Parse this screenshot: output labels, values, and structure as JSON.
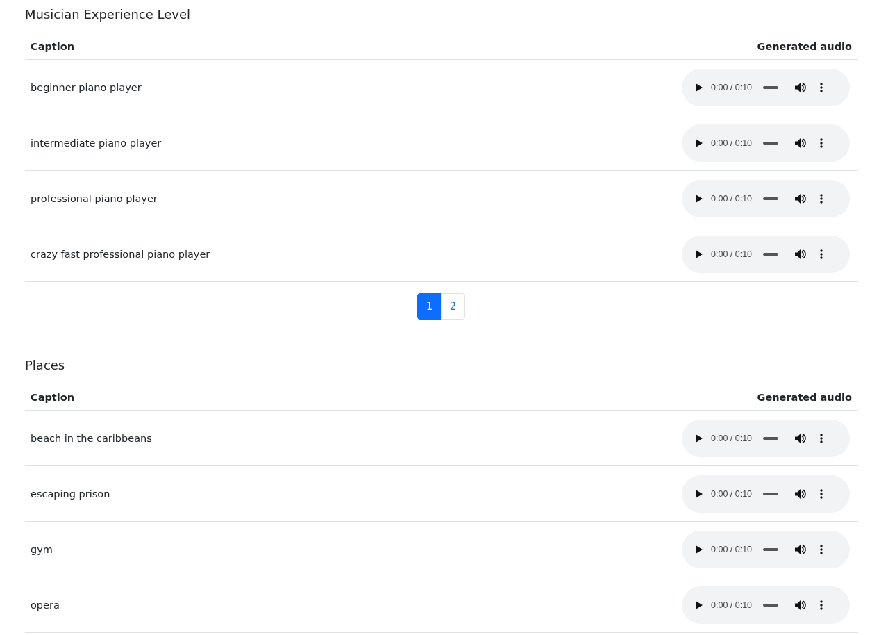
{
  "sections": [
    {
      "title": "Musician Experience Level",
      "columns": [
        "Caption",
        "Generated audio"
      ],
      "rows": [
        {
          "caption": "beginner piano player",
          "time": "0:00 / 0:10"
        },
        {
          "caption": "intermediate piano player",
          "time": "0:00 / 0:10"
        },
        {
          "caption": "professional piano player",
          "time": "0:00 / 0:10"
        },
        {
          "caption": "crazy fast professional piano player",
          "time": "0:00 / 0:10"
        }
      ],
      "pagination": [
        {
          "label": "1",
          "selected": true
        },
        {
          "label": "2",
          "selected": false
        }
      ]
    },
    {
      "title": "Places",
      "columns": [
        "Caption",
        "Generated audio"
      ],
      "rows": [
        {
          "caption": "beach in the caribbeans",
          "time": "0:00 / 0:10"
        },
        {
          "caption": "escaping prison",
          "time": "0:00 / 0:10"
        },
        {
          "caption": "gym",
          "time": "0:00 / 0:10"
        },
        {
          "caption": "opera",
          "time": "0:00 / 0:10"
        }
      ]
    }
  ]
}
